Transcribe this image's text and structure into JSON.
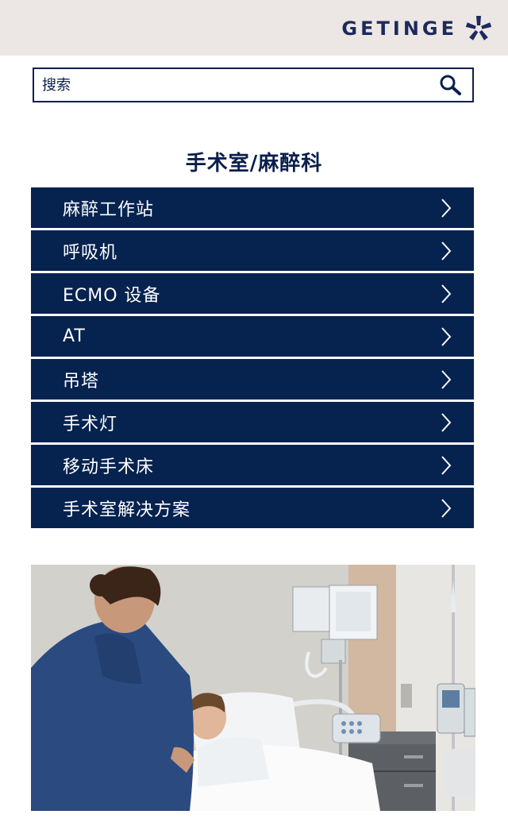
{
  "header": {
    "brand": "GETINGE",
    "logo_icon": "getinge-star-icon"
  },
  "search": {
    "placeholder": "搜索",
    "icon": "search-icon"
  },
  "page": {
    "title": "手术室/麻醉科"
  },
  "menu": {
    "items": [
      {
        "label": "麻醉工作站"
      },
      {
        "label": "呼吸机"
      },
      {
        "label": "ECMO 设备"
      },
      {
        "label": "AT"
      },
      {
        "label": "吊塔"
      },
      {
        "label": "手术灯"
      },
      {
        "label": "移动手术床"
      },
      {
        "label": "手术室解决方案"
      }
    ],
    "chevron_icon": "chevron-right-icon"
  },
  "colors": {
    "navy": "#06224f",
    "header_bg": "#ece6e4",
    "text": "#0b1f4d"
  },
  "hero": {
    "image": "nurse-with-patient-in-hospital-bed"
  }
}
